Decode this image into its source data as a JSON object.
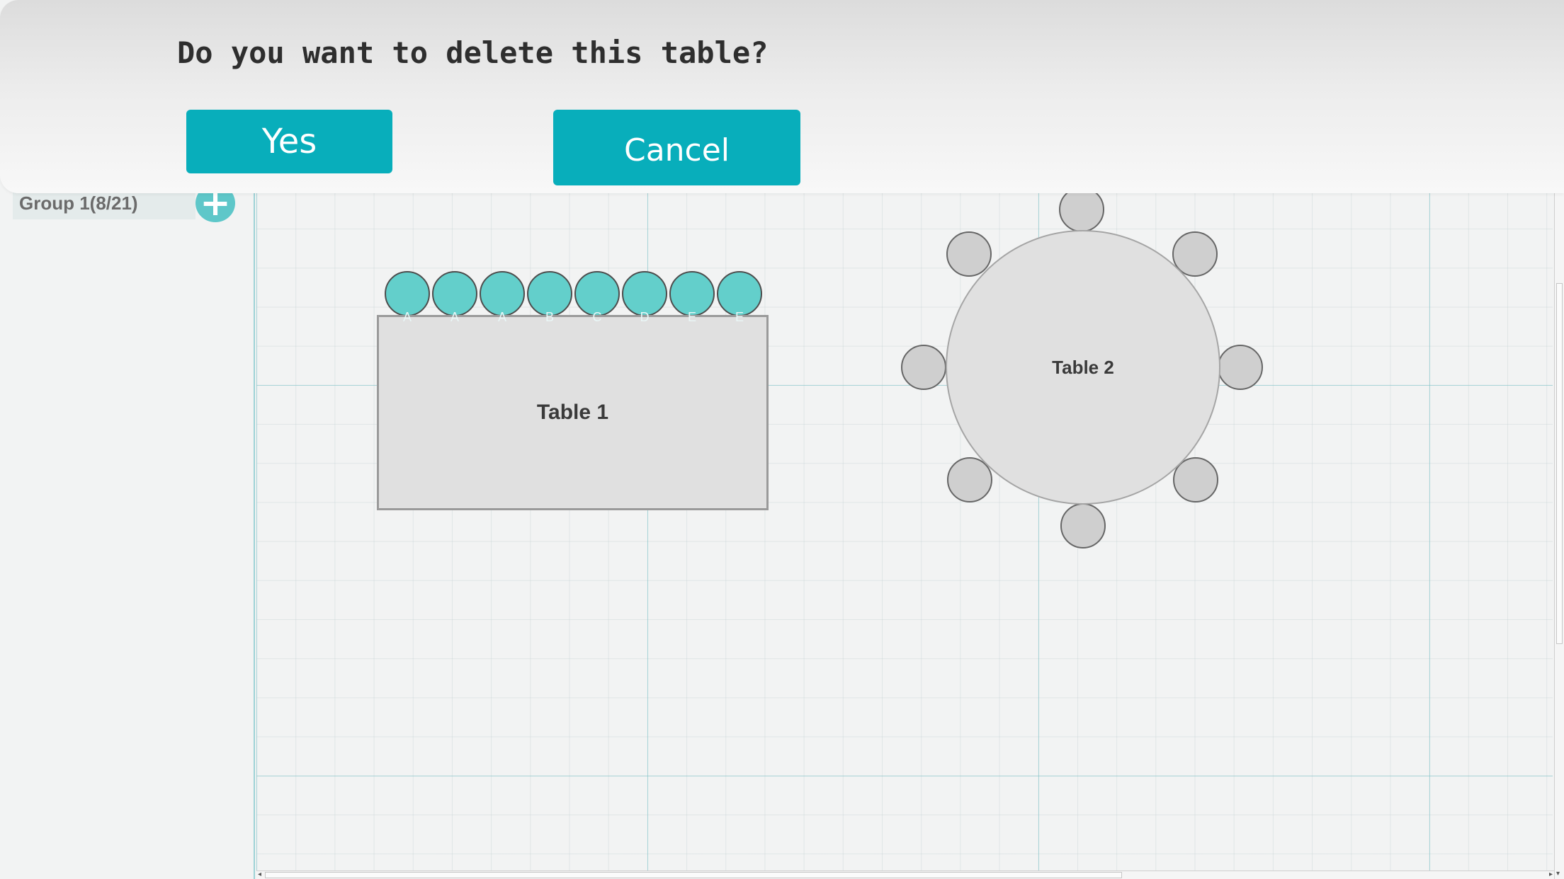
{
  "dialog": {
    "title": "Do you want to delete this table?",
    "yes_label": "Yes",
    "cancel_label": "Cancel"
  },
  "sidebar": {
    "group_label": "Group 1(8/21)",
    "add_icon": "plus-icon"
  },
  "tables": [
    {
      "label": "Table 1",
      "shape": "rectangle",
      "seats": [
        {
          "letter": "A",
          "occupied": true
        },
        {
          "letter": "A",
          "occupied": true
        },
        {
          "letter": "A",
          "occupied": true
        },
        {
          "letter": "B",
          "occupied": true
        },
        {
          "letter": "C",
          "occupied": true
        },
        {
          "letter": "D",
          "occupied": true
        },
        {
          "letter": "E",
          "occupied": true
        },
        {
          "letter": "E",
          "occupied": true
        }
      ]
    },
    {
      "label": "Table 2",
      "shape": "round",
      "seat_count": 8
    }
  ],
  "colors": {
    "accent": "#08aebb",
    "seat_occupied": "#63cfcb",
    "seat_empty": "#cfcfcf",
    "table_fill": "#e0e0e0"
  }
}
